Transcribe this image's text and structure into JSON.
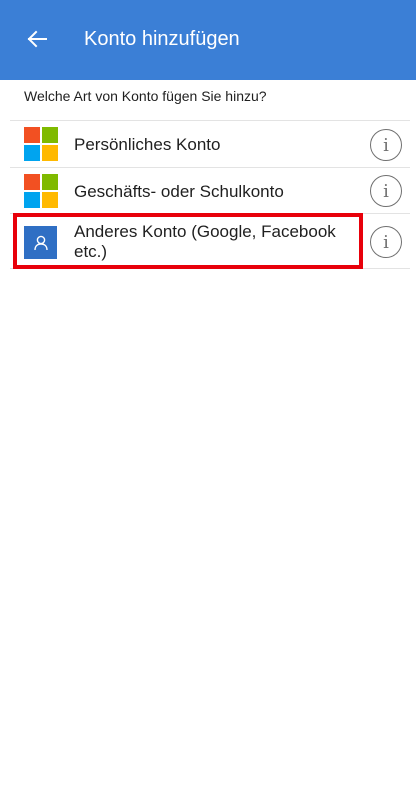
{
  "header": {
    "back_icon": "arrow-left-icon",
    "title": "Konto hinzufügen",
    "color": "#3b7fd6"
  },
  "prompt": "Welche Art von Konto fügen Sie hinzu?",
  "accounts": [
    {
      "label": "Persönliches Konto",
      "icon": "microsoft-logo-icon",
      "info_icon": "info-icon"
    },
    {
      "label": "Geschäfts- oder Schulkonto",
      "icon": "microsoft-logo-icon",
      "info_icon": "info-icon"
    },
    {
      "label": "Anderes Konto (Google, Facebook etc.)",
      "icon": "person-icon",
      "info_icon": "info-icon",
      "highlighted": true
    }
  ],
  "colors": {
    "highlight": "#e8000a",
    "ms_red": "#f25022",
    "ms_green": "#7fba00",
    "ms_blue": "#00a4ef",
    "ms_yellow": "#ffb900",
    "person_tile": "#2f6fc4"
  }
}
